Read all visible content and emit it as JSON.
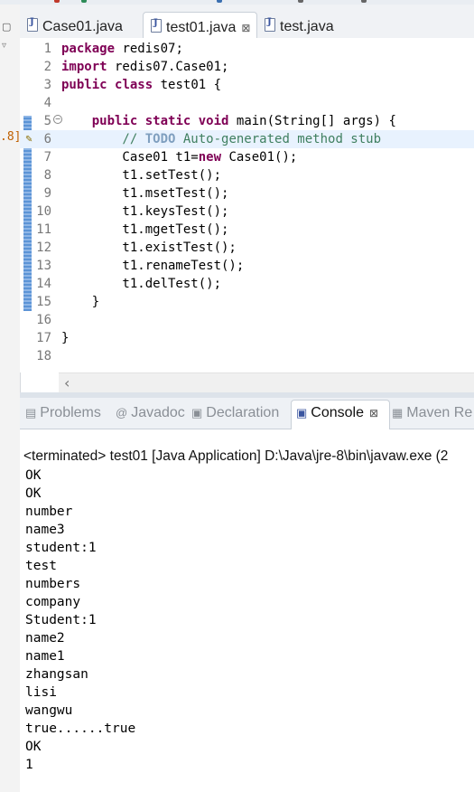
{
  "editor_tabs": [
    {
      "label": "Case01.java",
      "active": false
    },
    {
      "label": "test01.java",
      "active": true,
      "close": "⊠"
    },
    {
      "label": "test.java",
      "active": false
    }
  ],
  "left_edge_label": ".8]",
  "code_lines": [
    {
      "num": "1",
      "tokens": [
        {
          "t": "package",
          "c": "kw"
        },
        {
          "t": " redis07;",
          "c": ""
        }
      ]
    },
    {
      "num": "2",
      "tokens": [
        {
          "t": "import",
          "c": "kw"
        },
        {
          "t": " redis07.Case01;",
          "c": ""
        }
      ]
    },
    {
      "num": "3",
      "tokens": [
        {
          "t": "public",
          "c": "kw"
        },
        {
          "t": " ",
          "c": ""
        },
        {
          "t": "class",
          "c": "kw"
        },
        {
          "t": " test01 {",
          "c": ""
        }
      ]
    },
    {
      "num": "4",
      "tokens": []
    },
    {
      "num": "5",
      "fold": true,
      "tokens": [
        {
          "t": "    ",
          "c": ""
        },
        {
          "t": "public",
          "c": "kw"
        },
        {
          "t": " ",
          "c": ""
        },
        {
          "t": "static",
          "c": "kw"
        },
        {
          "t": " ",
          "c": ""
        },
        {
          "t": "void",
          "c": "kw"
        },
        {
          "t": " main(String[] args) {",
          "c": ""
        }
      ]
    },
    {
      "num": "6",
      "highlight": true,
      "warn": true,
      "tokens": [
        {
          "t": "        // ",
          "c": "cm"
        },
        {
          "t": "TODO",
          "c": "todo"
        },
        {
          "t": " Auto-generated method stub",
          "c": "cm"
        }
      ]
    },
    {
      "num": "7",
      "tokens": [
        {
          "t": "        Case01 t1=",
          "c": ""
        },
        {
          "t": "new",
          "c": "kw"
        },
        {
          "t": " Case01();",
          "c": ""
        }
      ]
    },
    {
      "num": "8",
      "tokens": [
        {
          "t": "        t1.setTest();",
          "c": ""
        }
      ]
    },
    {
      "num": "9",
      "tokens": [
        {
          "t": "        t1.msetTest();",
          "c": ""
        }
      ]
    },
    {
      "num": "10",
      "tokens": [
        {
          "t": "        t1.keysTest();",
          "c": ""
        }
      ]
    },
    {
      "num": "11",
      "tokens": [
        {
          "t": "        t1.mgetTest();",
          "c": ""
        }
      ]
    },
    {
      "num": "12",
      "tokens": [
        {
          "t": "        t1.existTest();",
          "c": ""
        }
      ]
    },
    {
      "num": "13",
      "tokens": [
        {
          "t": "        t1.renameTest();",
          "c": ""
        }
      ]
    },
    {
      "num": "14",
      "tokens": [
        {
          "t": "        t1.delTest();",
          "c": ""
        }
      ]
    },
    {
      "num": "15",
      "tokens": [
        {
          "t": "    }",
          "c": ""
        }
      ]
    },
    {
      "num": "16",
      "tokens": []
    },
    {
      "num": "17",
      "tokens": [
        {
          "t": "}",
          "c": ""
        }
      ]
    },
    {
      "num": "18",
      "tokens": []
    }
  ],
  "view_tabs": [
    {
      "label": "Problems",
      "icon": "problems-icon",
      "glyph": "▤",
      "active": false
    },
    {
      "label": "Javadoc",
      "icon": "javadoc-icon",
      "glyph": "@",
      "active": false
    },
    {
      "label": "Declaration",
      "icon": "declaration-icon",
      "glyph": "▣",
      "active": false
    },
    {
      "label": "Console",
      "icon": "console-icon",
      "glyph": "▣",
      "active": true,
      "close": "⊠"
    },
    {
      "label": "Maven Re",
      "icon": "maven-icon",
      "glyph": "▦",
      "active": false
    }
  ],
  "console": {
    "terminated": "<terminated> test01 [Java Application] D:\\Java\\jre-8\\bin\\javaw.exe (2",
    "output": [
      "OK",
      "OK",
      "number",
      "name3",
      "student:1",
      "test",
      "numbers",
      "company",
      "Student:1",
      "name2",
      "name1",
      "zhangsan",
      "lisi",
      "wangwu",
      "true......true",
      "OK",
      "1"
    ]
  },
  "colors": {
    "keyword": "#7f0055",
    "comment": "#3f7f5f",
    "todo": "#7f9fbf",
    "line_highlight": "#e8f2fe"
  }
}
